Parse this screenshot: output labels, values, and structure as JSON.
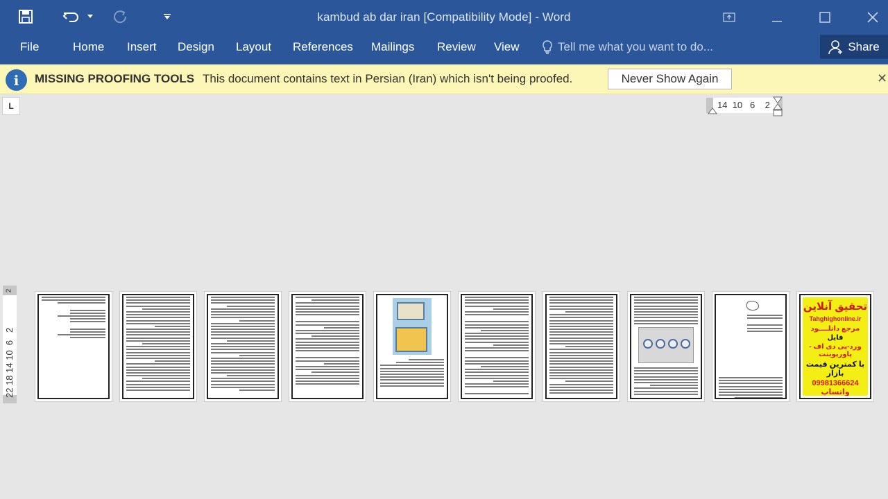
{
  "window": {
    "title": "kambud ab dar iran [Compatibility Mode] - Word",
    "accent": "#2b579a"
  },
  "ribbon": {
    "tabs": [
      "File",
      "Home",
      "Insert",
      "Design",
      "Layout",
      "References",
      "Mailings",
      "Review",
      "View"
    ],
    "tell_me_placeholder": "Tell me what you want to do...",
    "share_label": "Share"
  },
  "message_bar": {
    "title": "MISSING PROOFING TOOLS",
    "text": "This document contains text in Persian (Iran) which isn't being proofed.",
    "button": "Never Show Again",
    "background": "#fcf7b6"
  },
  "rulers": {
    "tab_selector": "L",
    "horizontal": "14  10   6    2",
    "vertical": "22 18 14 10  6   2",
    "vertical_top": "2"
  },
  "pages": {
    "count": 10,
    "ad": {
      "title": "تحقیق آنلاین",
      "url": "Tahghighonline.ir",
      "line1": "مرجع دانلــــود",
      "line2": "فایل",
      "line3": "ورد-پی دی اف - پاورپوینت",
      "line4": "با کمترین قیمت بازار",
      "line5": "09981366624 واتساپ"
    }
  }
}
